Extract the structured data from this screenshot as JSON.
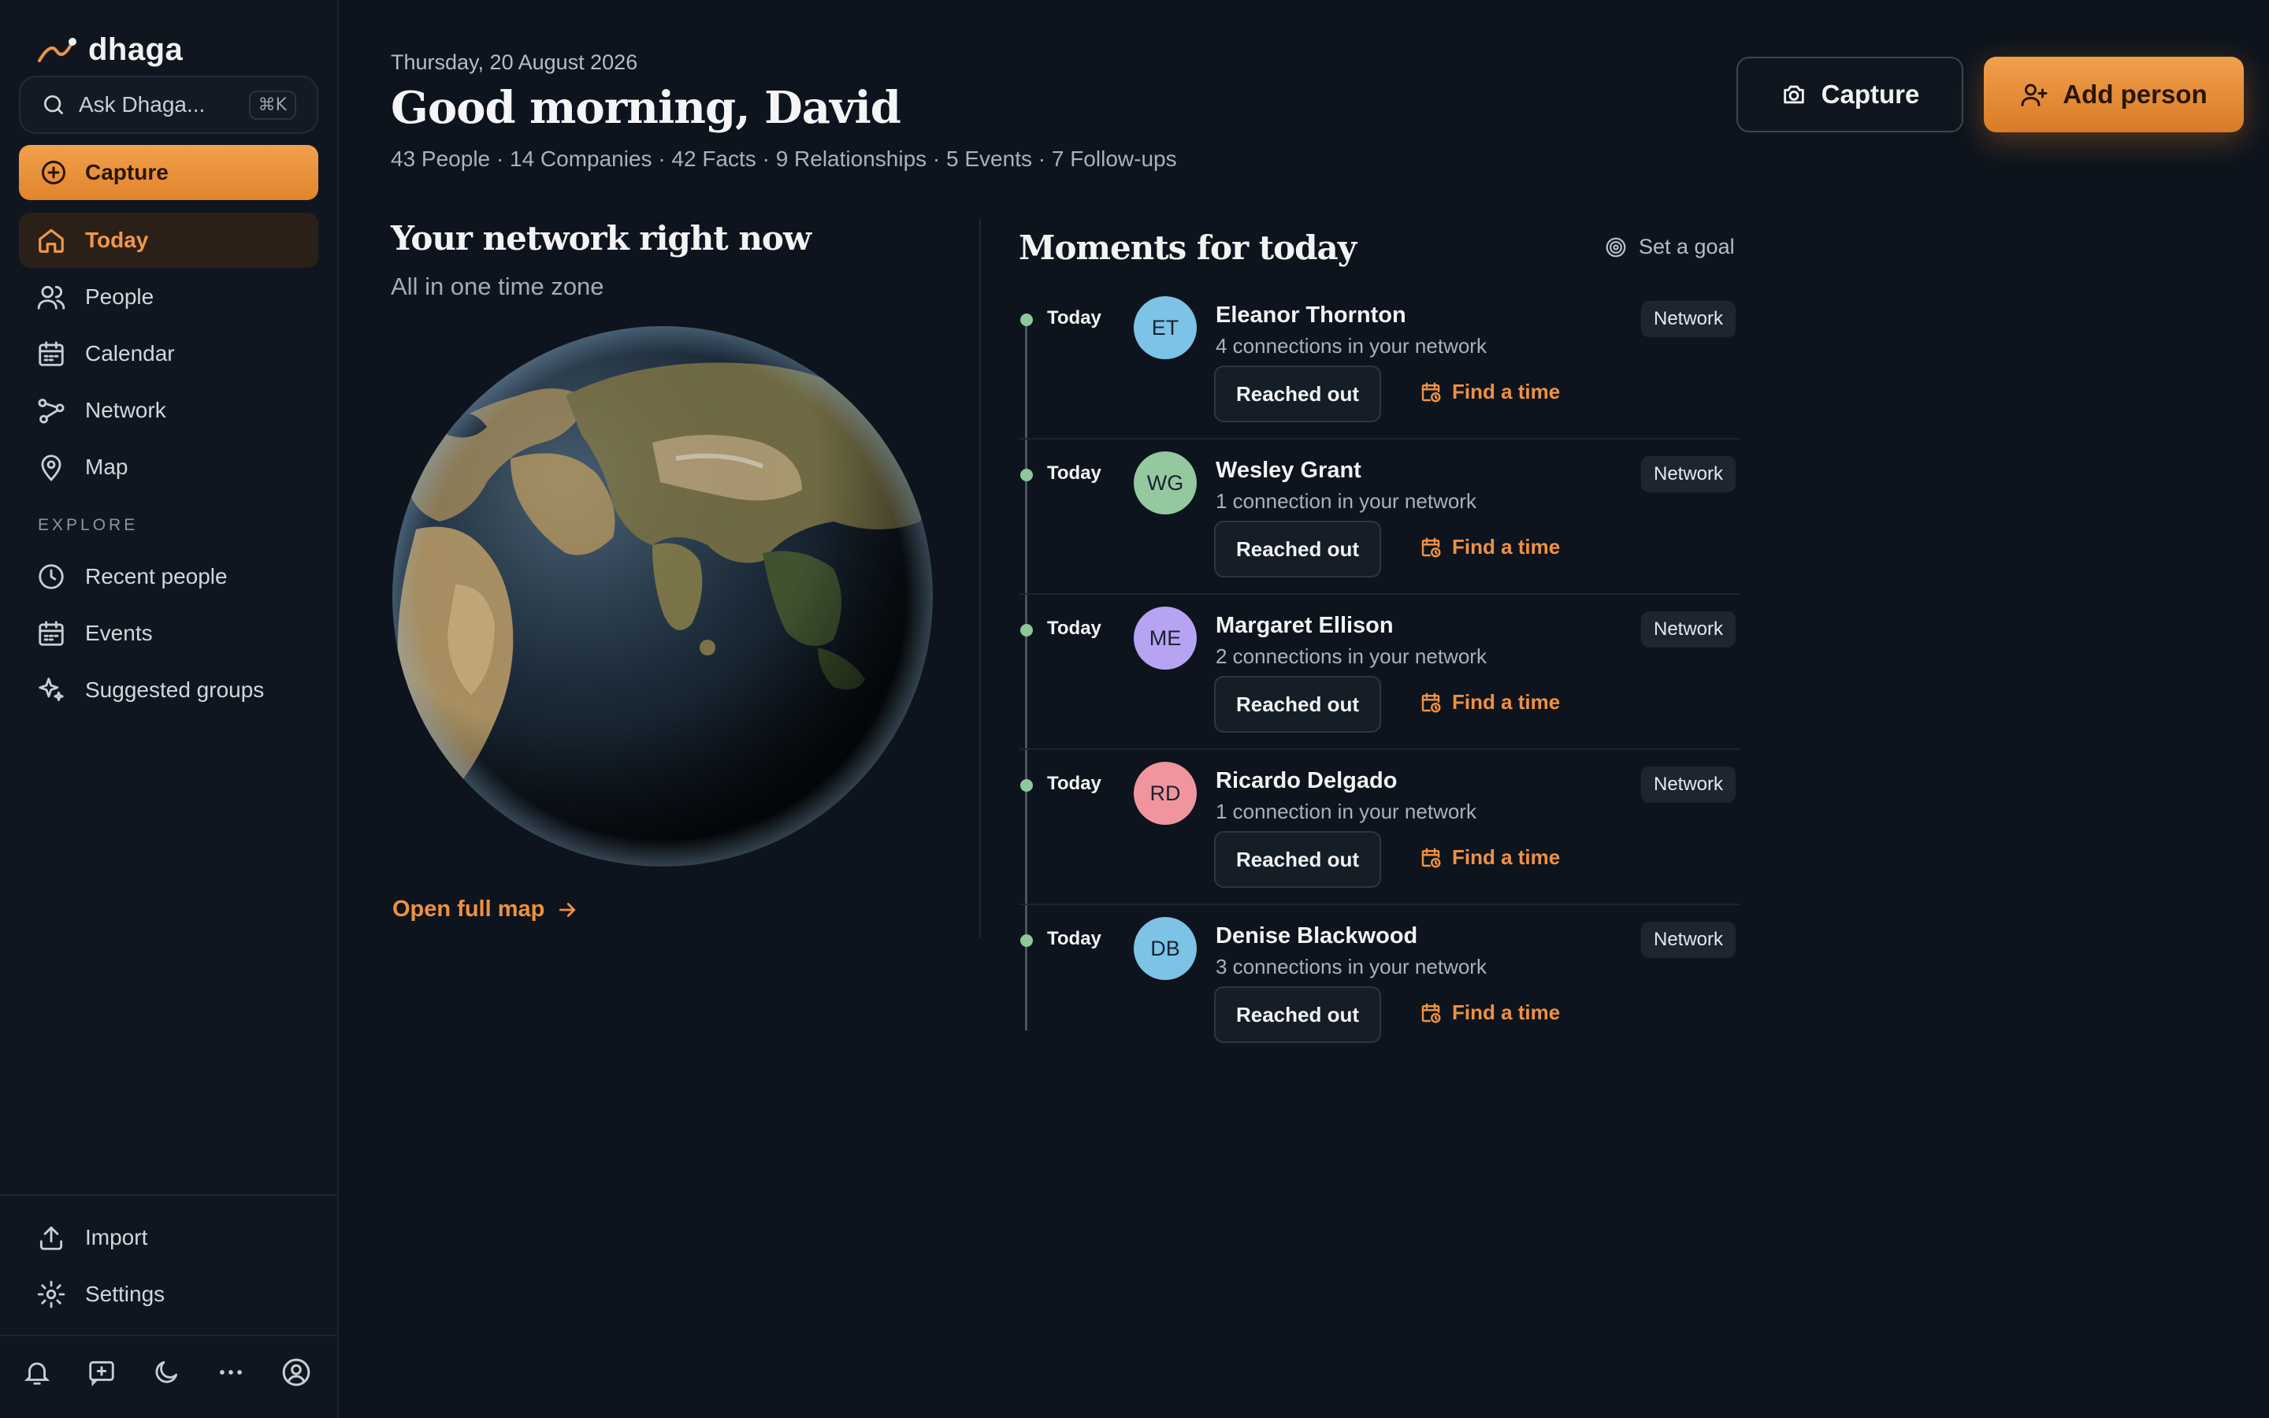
{
  "app": {
    "name": "dhaga"
  },
  "sidebar": {
    "search_placeholder": "Ask Dhaga...",
    "search_shortcut": "⌘K",
    "capture_label": "Capture",
    "nav": [
      {
        "label": "Today",
        "icon": "home-icon",
        "active": true
      },
      {
        "label": "People",
        "icon": "people-icon"
      },
      {
        "label": "Calendar",
        "icon": "calendar-icon"
      },
      {
        "label": "Network",
        "icon": "network-icon"
      },
      {
        "label": "Map",
        "icon": "map-pin-icon"
      }
    ],
    "explore_label": "EXPLORE",
    "explore": [
      {
        "label": "Recent people",
        "icon": "clock-icon"
      },
      {
        "label": "Events",
        "icon": "calendar-icon"
      },
      {
        "label": "Suggested groups",
        "icon": "sparkle-icon"
      }
    ],
    "footer": [
      {
        "label": "Import",
        "icon": "upload-icon"
      },
      {
        "label": "Settings",
        "icon": "gear-icon"
      }
    ]
  },
  "header": {
    "date": "Thursday, 20 August 2026",
    "greeting": "Good morning, David",
    "stats": "43 People · 14 Companies · 42 Facts · 9 Relationships · 5 Events · 7 Follow-ups",
    "capture_label": "Capture",
    "add_person_label": "Add person"
  },
  "network": {
    "title": "Your network right now",
    "subtitle": "All in one time zone",
    "open_map_label": "Open full map"
  },
  "moments": {
    "title": "Moments for today",
    "set_goal_label": "Set a goal",
    "items": [
      {
        "when": "Today",
        "initials": "ET",
        "name": "Eleanor Thornton",
        "connections": "4 connections in your network",
        "badge": "Network",
        "avatar_color": "#7cc3e6",
        "reached_label": "Reached out",
        "find_label": "Find a time"
      },
      {
        "when": "Today",
        "initials": "WG",
        "name": "Wesley Grant",
        "connections": "1 connection in your network",
        "badge": "Network",
        "avatar_color": "#94c9a0",
        "reached_label": "Reached out",
        "find_label": "Find a time"
      },
      {
        "when": "Today",
        "initials": "ME",
        "name": "Margaret Ellison",
        "connections": "2 connections in your network",
        "badge": "Network",
        "avatar_color": "#b6a3f2",
        "reached_label": "Reached out",
        "find_label": "Find a time"
      },
      {
        "when": "Today",
        "initials": "RD",
        "name": "Ricardo Delgado",
        "connections": "1 connection in your network",
        "badge": "Network",
        "avatar_color": "#f0959f",
        "reached_label": "Reached out",
        "find_label": "Find a time"
      },
      {
        "when": "Today",
        "initials": "DB",
        "name": "Denise Blackwood",
        "connections": "3 connections in your network",
        "badge": "Network",
        "avatar_color": "#7cc3e6",
        "reached_label": "Reached out",
        "find_label": "Find a time"
      }
    ]
  },
  "colors": {
    "accent": "#ef9143",
    "background": "#0d141d",
    "sidebar": "#0f1620",
    "timeline_dot": "#8fc79c"
  }
}
